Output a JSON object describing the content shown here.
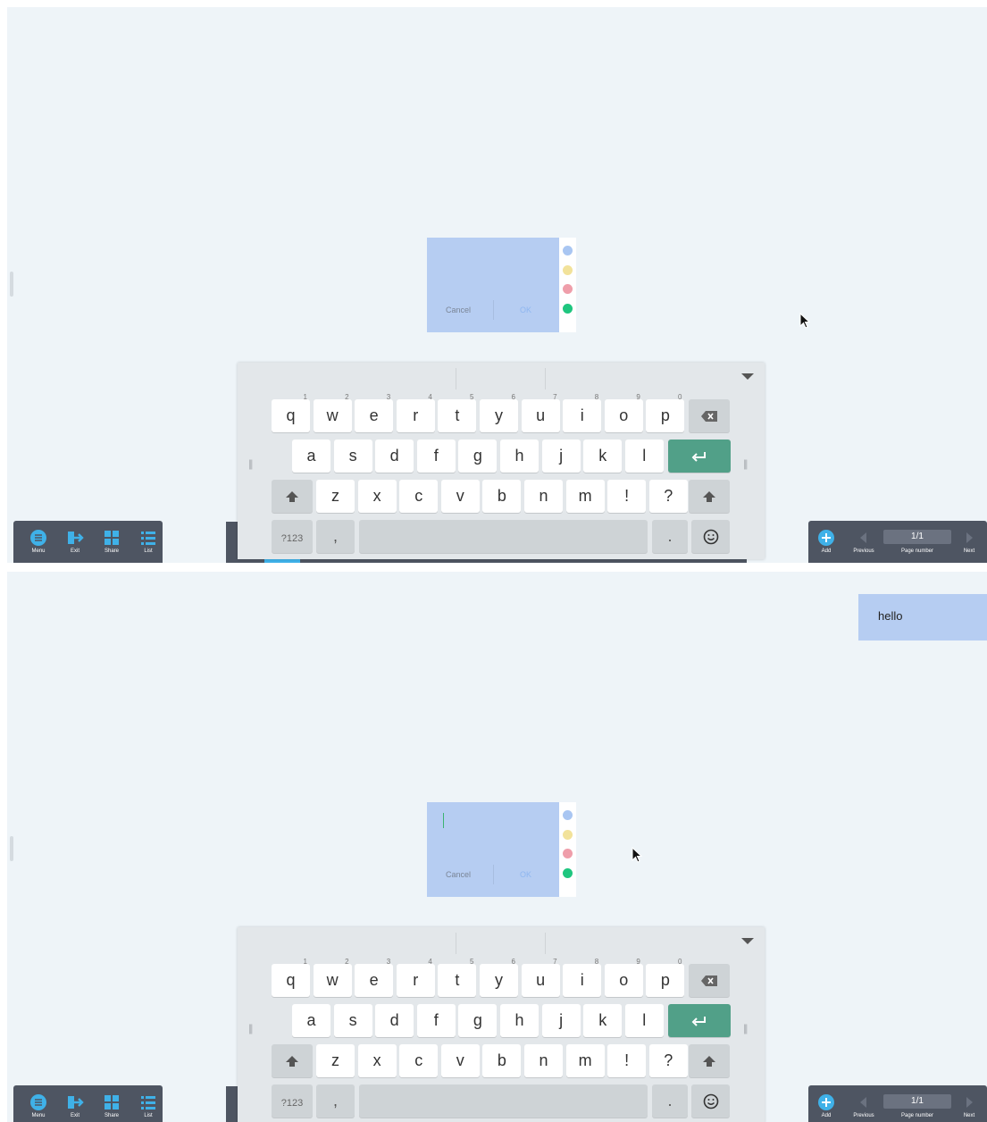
{
  "frames": [
    {
      "note": {
        "cancel_label": "Cancel",
        "ok_label": "OK",
        "colors": [
          "#a9c6f2",
          "#f2e29a",
          "#ef9eaa",
          "#1fc67f"
        ],
        "editing": false
      },
      "hello_note": null
    },
    {
      "note": {
        "cancel_label": "Cancel",
        "ok_label": "OK",
        "colors": [
          "#a9c6f2",
          "#f2e29a",
          "#ef9eaa",
          "#1fc67f"
        ],
        "editing": true
      },
      "hello_note": {
        "text": "hello"
      }
    }
  ],
  "keyboard": {
    "row1": [
      {
        "k": "q",
        "n": "1"
      },
      {
        "k": "w",
        "n": "2"
      },
      {
        "k": "e",
        "n": "3"
      },
      {
        "k": "r",
        "n": "4"
      },
      {
        "k": "t",
        "n": "5"
      },
      {
        "k": "y",
        "n": "6"
      },
      {
        "k": "u",
        "n": "7"
      },
      {
        "k": "i",
        "n": "8"
      },
      {
        "k": "o",
        "n": "9"
      },
      {
        "k": "p",
        "n": "0"
      }
    ],
    "row2": [
      "a",
      "s",
      "d",
      "f",
      "g",
      "h",
      "j",
      "k",
      "l"
    ],
    "row3": [
      "z",
      "x",
      "c",
      "v",
      "b",
      "n",
      "m",
      "!",
      "?"
    ],
    "symbols_label": "?123",
    "comma": ",",
    "period": "."
  },
  "left_toolbar": [
    {
      "label": "Menu",
      "icon": "menu-icon"
    },
    {
      "label": "Exit",
      "icon": "exit-icon"
    },
    {
      "label": "Share",
      "icon": "share-icon"
    },
    {
      "label": "List",
      "icon": "list-icon"
    }
  ],
  "right_toolbar": {
    "add_label": "Add",
    "previous_label": "Previous",
    "page_number": "1/1",
    "page_number_label": "Page number",
    "next_label": "Next"
  },
  "accent_color": "#3fb1e8"
}
